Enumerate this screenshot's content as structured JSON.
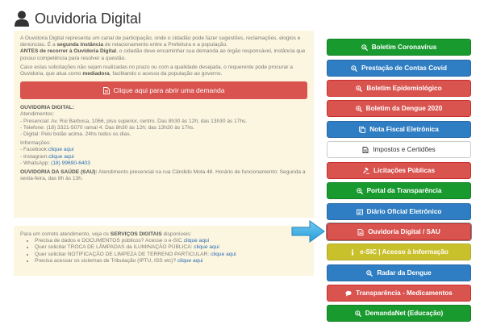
{
  "page": {
    "title": "Ouvidoria Digital"
  },
  "intro": {
    "p1_a": "A Ouvidoria Digital representa um canal de participação, onde o cidadão pode fazer sugestões, reclamações, elogios e denúncias. É a ",
    "p1_b": "segunda instância",
    "p1_c": " de relacionamento entre a Prefeitura e a população.",
    "p2_a": "ANTES de recorrer à Ouvidoria Digital",
    "p2_b": ", o cidadão deve encaminhar sua demanda ao órgão responsável, instância que possui competência para resolver a questão.",
    "p3_a": "Caso estas solicitações não sejam realizadas no prazo ou com a qualidade desejada, o requerente pode procurar a Ouvidoria, que atua como ",
    "p3_b": "mediadora",
    "p3_c": ", facilitando o acesso da população ao governo."
  },
  "demand_button": {
    "label": "Clique aqui para abrir uma demanda"
  },
  "ouvidoria": {
    "heading": "OUVIDORIA DIGITAL:",
    "atend_label": "Atendimentos:",
    "presencial": "- Presencial: Av. Rui Barbosa, 1066, piso superior, centro. Das 8h30 às 12h; das 13h30 às 17hs.",
    "telefone": "- Telefone: (18) 3321-5070 ramal 4. Das 8h30 às 12h; das 13h30 às 17hs.",
    "digital": "- Digital: Pelo botão acima. 24hs todos os dias.",
    "info_label": "Informações:",
    "facebook_label": "- Facebook:",
    "facebook_link": "clique aqui",
    "instagram_label": "- Instagram:",
    "instagram_link": "clique aqui",
    "whatsapp_label": "- WhatsApp: ",
    "whatsapp_link": "(18) 99690-6403",
    "saude_label": "OUVIDORIA DA SAÚDE (SAU):",
    "saude_text": " Atendimento presencial na rua Cândido Mota 48. Horário de funcionamento: Segunda a sexta-feira, das 8h às 13h."
  },
  "servicos": {
    "intro_a": "Para um correto atendimento, veja os ",
    "intro_b": "SERVIÇOS DIGITAIS",
    "intro_c": " disponíveis:",
    "items": [
      {
        "text": "Precisa de dados e DOCUMENTOS públicos? Acesse o e-SIC ",
        "link": "clique aqui"
      },
      {
        "text": "Quer solicitar TROCA DE LÂMPADAS da ILUMINAÇÃO PÚBLICA: ",
        "link": "clique aqui"
      },
      {
        "text": "Quer solicitar NOTIFICAÇÃO DE LIMPEZA DE TERRENO PARTICULAR: ",
        "link": "clique aqui"
      },
      {
        "text": "Precisa acessar os sistemas de Tributação (IPTU, ISS etc)? ",
        "link": "clique aqui"
      }
    ]
  },
  "sidebar": {
    "buttons": [
      {
        "label": "Boletim Coronavírus",
        "icon": "search-plus-icon",
        "color": "#189a2e"
      },
      {
        "label": "Prestação de Contas Covid",
        "icon": "search-plus-icon",
        "color": "#2f7dc2"
      },
      {
        "label": "Boletim Epidemiológico",
        "icon": "search-plus-icon",
        "color": "#d9534f"
      },
      {
        "label": "Boletim da Dengue 2020",
        "icon": "search-plus-icon",
        "color": "#d9534f"
      },
      {
        "label": "Nota Fiscal Eletrônica",
        "icon": "copy-icon",
        "color": "#2f7dc2"
      },
      {
        "label": "Impostos e Certidões",
        "icon": "document-icon",
        "color": "#ffffff"
      },
      {
        "label": "Licitações Públicas",
        "icon": "gavel-icon",
        "color": "#d9534f"
      },
      {
        "label": "Portal da Transparência",
        "icon": "search-plus-icon",
        "color": "#189a2e"
      },
      {
        "label": "Diário Oficial Eletrônico",
        "icon": "newspaper-icon",
        "color": "#2f7dc2"
      },
      {
        "label": "Ouvidoria Digital / SAU",
        "icon": "document-icon",
        "color": "#d9534f"
      },
      {
        "label": "e-SIC | Acesso à Informação",
        "icon": "info-icon",
        "color": "#c9c12b"
      },
      {
        "label": "Radar da Dengue",
        "icon": "search-plus-icon",
        "color": "#2f7dc2"
      },
      {
        "label": "Transparência - Medicamentos",
        "icon": "chat-icon",
        "color": "#d9534f"
      },
      {
        "label": "DemandaNet (Educação)",
        "icon": "search-plus-icon",
        "color": "#189a2e"
      }
    ]
  }
}
